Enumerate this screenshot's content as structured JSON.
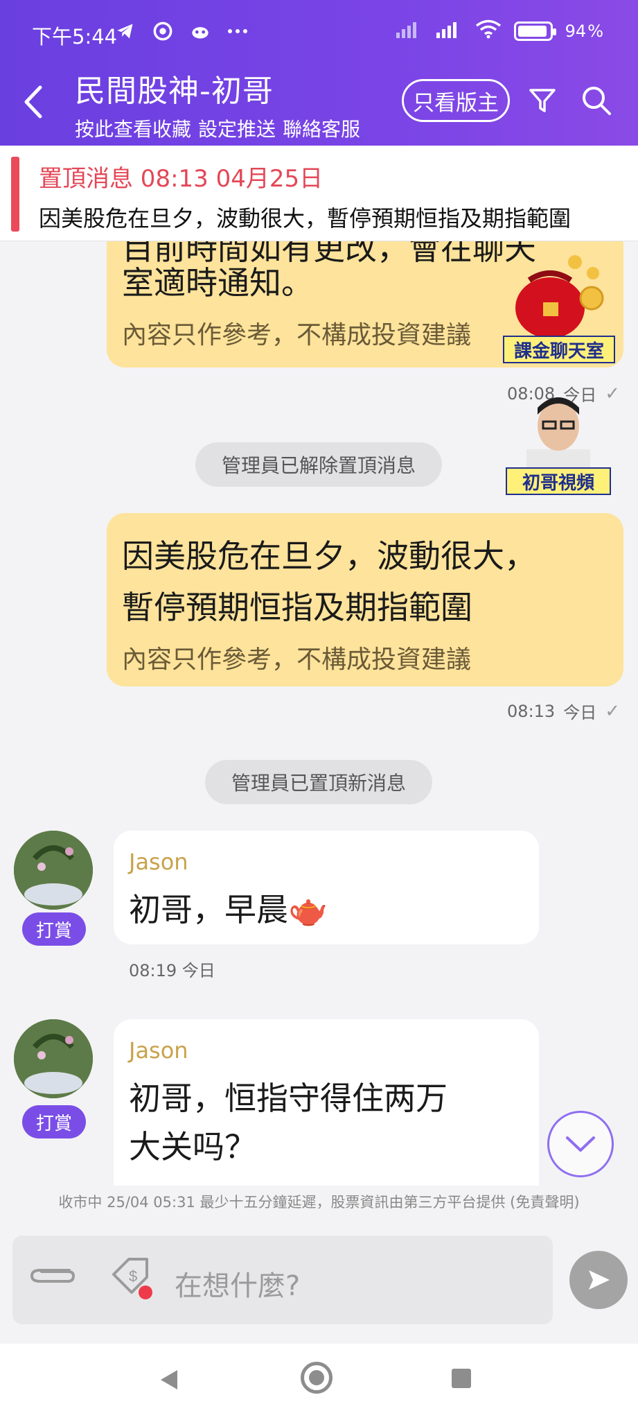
{
  "status_bar": {
    "time": "下午5:44",
    "icons": [
      "telegram-icon",
      "chrome-icon",
      "app-icon",
      "more-icon"
    ],
    "battery": "94",
    "battery_level": 0.94
  },
  "header": {
    "title": "民間股神-初哥",
    "links": [
      "按此查看收藏",
      "設定推送",
      "聯絡客服"
    ],
    "owner_only_label": "只看版主",
    "accent": "#6a3fe0"
  },
  "pinned": {
    "header": "置頂消息 08:13 04月25日",
    "text": "因美股危在旦夕，波動很大，暫停預期恒指及期指範圍"
  },
  "messages": {
    "m1": {
      "line1": "目前時間如有更改，會在聊天",
      "line2": "室適時通知。",
      "disclaimer": "內容只作參考，不構成投資建議",
      "time": "08:08",
      "day": "今日"
    },
    "sys1": "管理員已解除置頂消息",
    "m2": {
      "line1": "因美股危在旦夕，波動很大，",
      "line2": "暫停預期恒指及期指範圍",
      "disclaimer": "內容只作參考，不構成投資建議",
      "time": "08:13",
      "day": "今日"
    },
    "sys2": "管理員已置頂新消息",
    "m3": {
      "name": "Jason",
      "text": "初哥，早晨🫖",
      "tip": "打賞",
      "time": "08:19 今日"
    },
    "m4": {
      "name": "Jason",
      "line1": "初哥，恒指守得住两万",
      "line2": "大关吗？",
      "tip": "打賞"
    }
  },
  "widgets": {
    "redpacket_label": "課金聊天室",
    "video_label": "初哥視頻"
  },
  "market_note": "收市中 25/04 05:31 最少十五分鐘延遲，股票資訊由第三方平台提供 (免責聲明)",
  "composer": {
    "placeholder": "在想什麼?"
  }
}
